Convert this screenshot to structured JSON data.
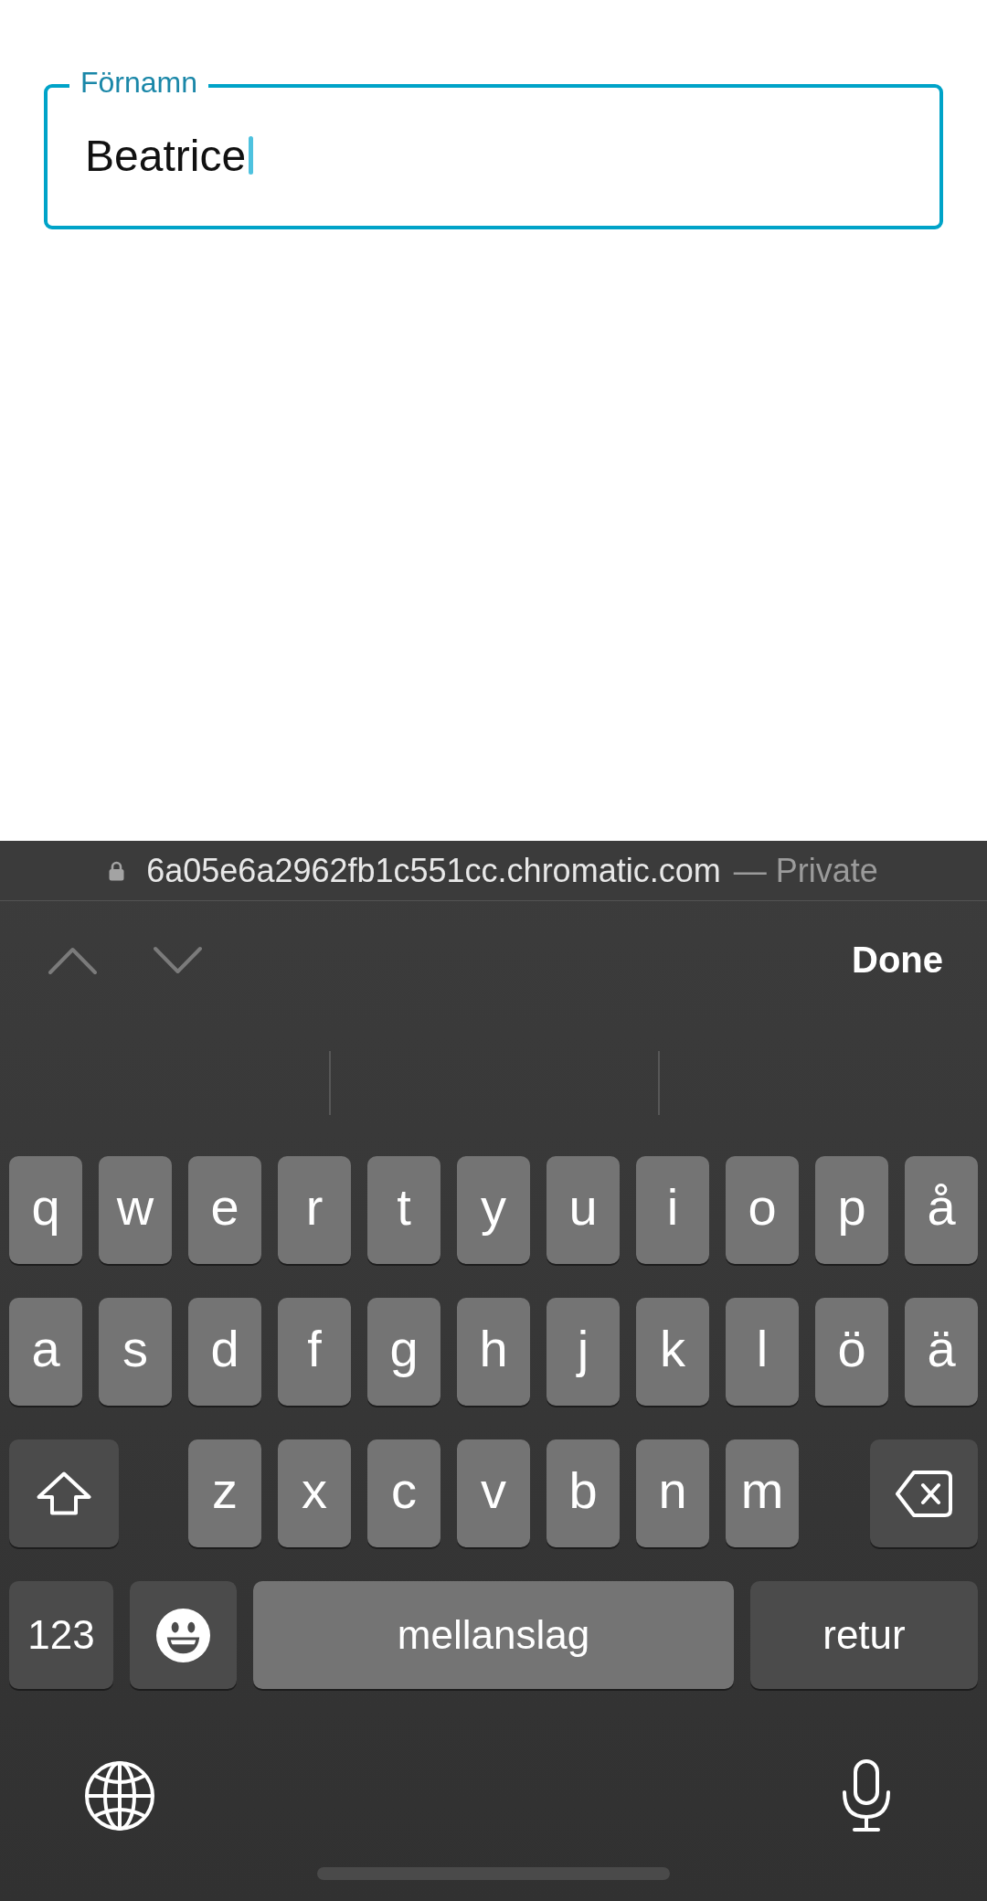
{
  "form": {
    "field": {
      "label": "Förnamn",
      "value": "Beatrice",
      "focused": true
    }
  },
  "address_bar": {
    "url": "6a05e6a2962fb1c551cc.chromatic.com",
    "mode": "— Private"
  },
  "keyboard_toolbar": {
    "navigation": [
      {
        "kind": "previous",
        "disabled": true
      },
      {
        "kind": "next",
        "disabled": true
      }
    ],
    "done": "Done"
  },
  "keyboard": {
    "shift_on": false,
    "letter_rows": [
      [
        {
          "kind": "letter",
          "label": "q"
        },
        {
          "kind": "letter",
          "label": "w"
        },
        {
          "kind": "letter",
          "label": "e"
        },
        {
          "kind": "letter",
          "label": "r"
        },
        {
          "kind": "letter",
          "label": "t"
        },
        {
          "kind": "letter",
          "label": "y"
        },
        {
          "kind": "letter",
          "label": "u"
        },
        {
          "kind": "letter",
          "label": "i"
        },
        {
          "kind": "letter",
          "label": "o"
        },
        {
          "kind": "letter",
          "label": "p"
        },
        {
          "kind": "letter",
          "label": "å"
        }
      ],
      [
        {
          "kind": "letter",
          "label": "a"
        },
        {
          "kind": "letter",
          "label": "s"
        },
        {
          "kind": "letter",
          "label": "d"
        },
        {
          "kind": "letter",
          "label": "f"
        },
        {
          "kind": "letter",
          "label": "g"
        },
        {
          "kind": "letter",
          "label": "h"
        },
        {
          "kind": "letter",
          "label": "j"
        },
        {
          "kind": "letter",
          "label": "k"
        },
        {
          "kind": "letter",
          "label": "l"
        },
        {
          "kind": "letter",
          "label": "ö"
        },
        {
          "kind": "letter",
          "label": "ä"
        }
      ]
    ],
    "third_row": [
      {
        "kind": "shift"
      },
      {
        "kind": "letter",
        "label": "z"
      },
      {
        "kind": "letter",
        "label": "x"
      },
      {
        "kind": "letter",
        "label": "c"
      },
      {
        "kind": "letter",
        "label": "v"
      },
      {
        "kind": "letter",
        "label": "b"
      },
      {
        "kind": "letter",
        "label": "n"
      },
      {
        "kind": "letter",
        "label": "m"
      },
      {
        "kind": "delete"
      }
    ],
    "function_row": [
      {
        "kind": "numbers",
        "label": "123"
      },
      {
        "kind": "emoji"
      },
      {
        "kind": "space",
        "label": "mellanslag"
      },
      {
        "kind": "return",
        "label": "retur"
      }
    ],
    "system_keys": [
      {
        "kind": "globe"
      },
      {
        "kind": "dictation"
      }
    ]
  }
}
